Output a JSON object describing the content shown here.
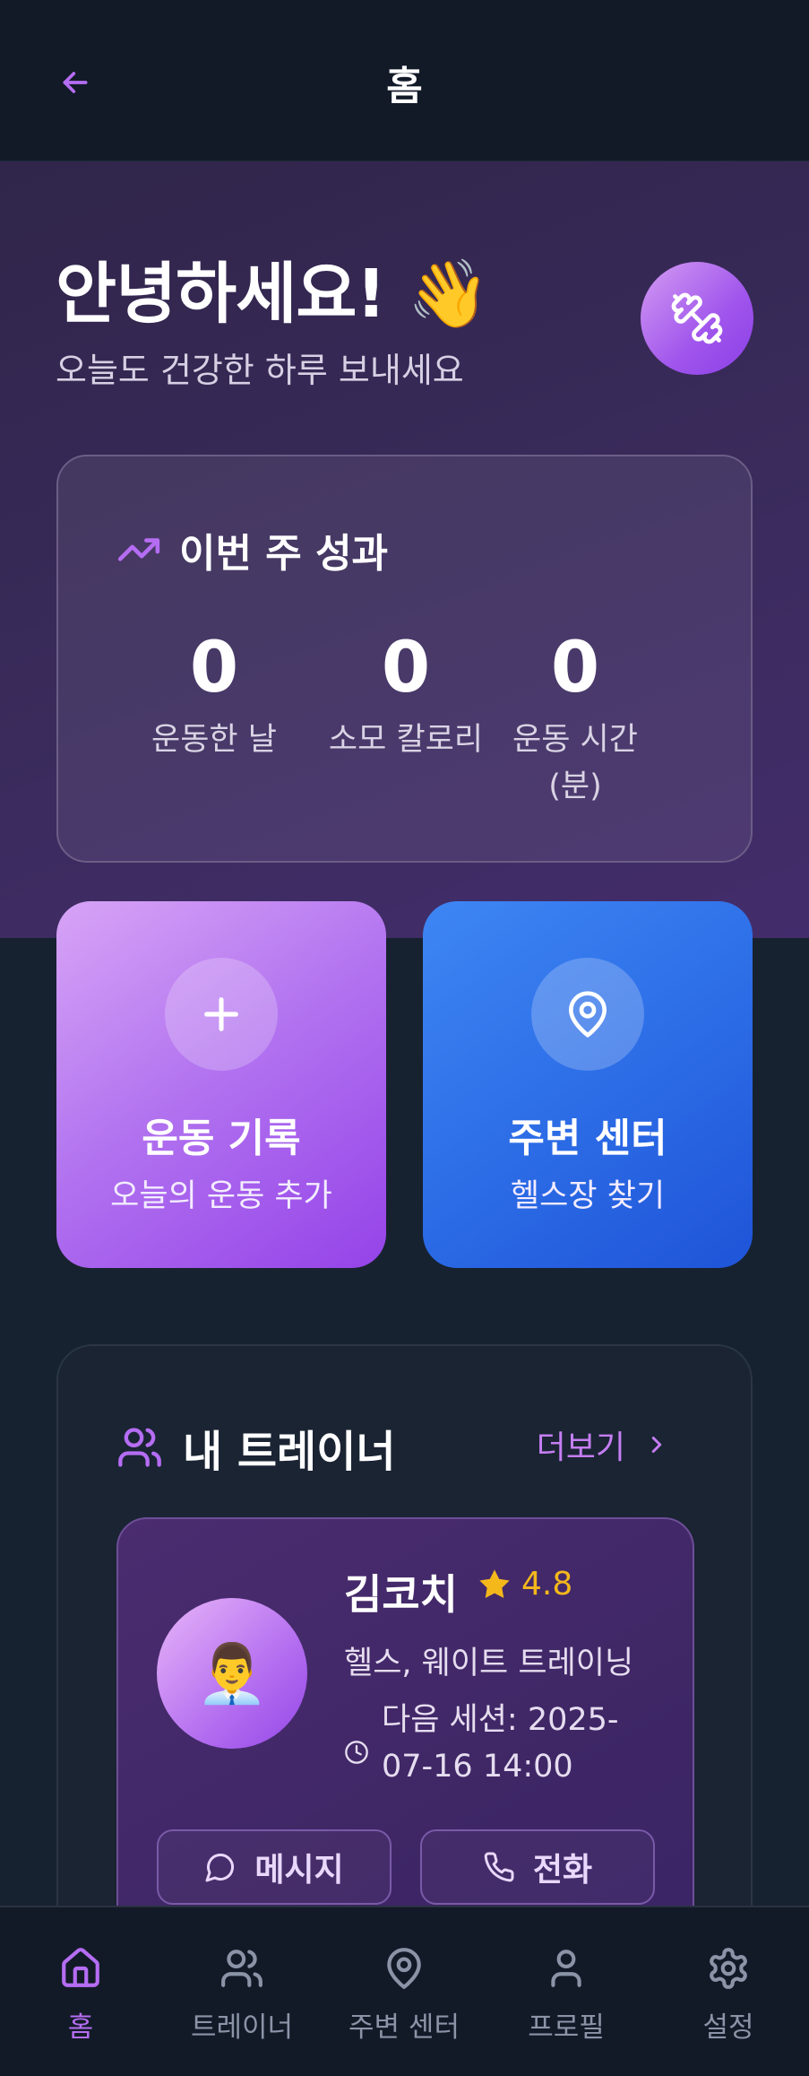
{
  "header": {
    "title": "홈"
  },
  "hero": {
    "greeting": "안녕하세요! 👋",
    "subtitle": "오늘도 건강한 하루 보내세요"
  },
  "weekly_stats": {
    "title": "이번 주 성과",
    "items": [
      {
        "value": "0",
        "label": "운동한 날"
      },
      {
        "value": "0",
        "label": "소모 칼로리"
      },
      {
        "value": "0",
        "label": "운동 시간 (분)"
      }
    ]
  },
  "actions": [
    {
      "title": "운동 기록",
      "subtitle": "오늘의 운동 추가",
      "icon": "plus-icon"
    },
    {
      "title": "주변 센터",
      "subtitle": "헬스장 찾기",
      "icon": "map-pin-icon"
    }
  ],
  "trainers": {
    "title": "내 트레이너",
    "more_label": "더보기",
    "card": {
      "avatar_emoji": "👨‍💼",
      "name": "김코치",
      "rating": "4.8",
      "specialty": "헬스, 웨이트 트레이닝",
      "next_session": "다음 세션: 2025-07-16 14:00",
      "message_label": "메시지",
      "call_label": "전화"
    }
  },
  "nav": {
    "items": [
      {
        "label": "홈",
        "icon": "home-icon",
        "active": true
      },
      {
        "label": "트레이너",
        "icon": "users-icon",
        "active": false
      },
      {
        "label": "주변 센터",
        "icon": "map-pin-icon",
        "active": false
      },
      {
        "label": "프로필",
        "icon": "user-icon",
        "active": false
      },
      {
        "label": "설정",
        "icon": "gear-icon",
        "active": false
      }
    ]
  },
  "colors": {
    "accent": "#b56df3",
    "background": "#172230",
    "rating_star": "#f5b81b",
    "blue_card": "#2d6ee7",
    "purple_card": "#a055ec"
  }
}
